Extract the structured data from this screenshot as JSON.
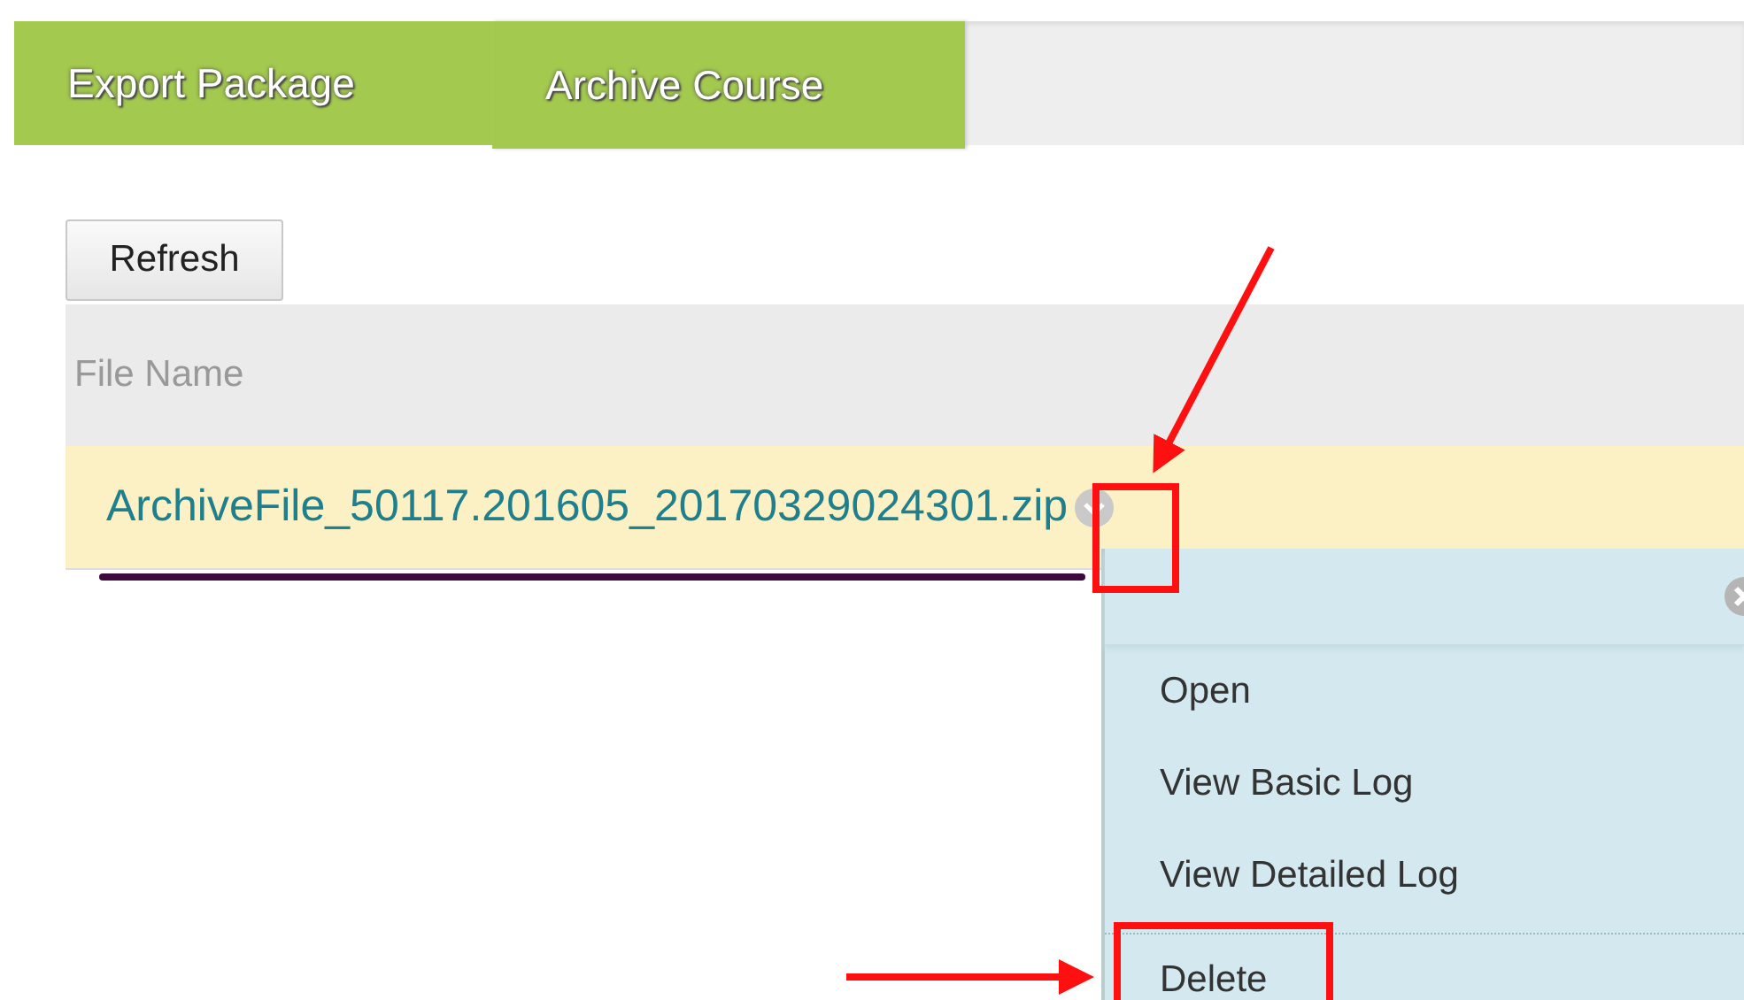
{
  "tabs": [
    {
      "label": "Export Package",
      "selected": false
    },
    {
      "label": "Archive Course",
      "selected": true
    }
  ],
  "refresh_button": "Refresh",
  "table": {
    "columns": [
      "File Name"
    ],
    "rows": [
      {
        "file_name": "ArchiveFile_50117.201605_20170329024301.zip",
        "highlighted": true
      }
    ]
  },
  "context_menu": {
    "items": [
      {
        "label": "Open",
        "separator_before": false
      },
      {
        "label": "View Basic Log",
        "separator_before": false
      },
      {
        "label": "View Detailed Log",
        "separator_before": false
      },
      {
        "label": "Delete",
        "separator_before": true
      }
    ]
  }
}
